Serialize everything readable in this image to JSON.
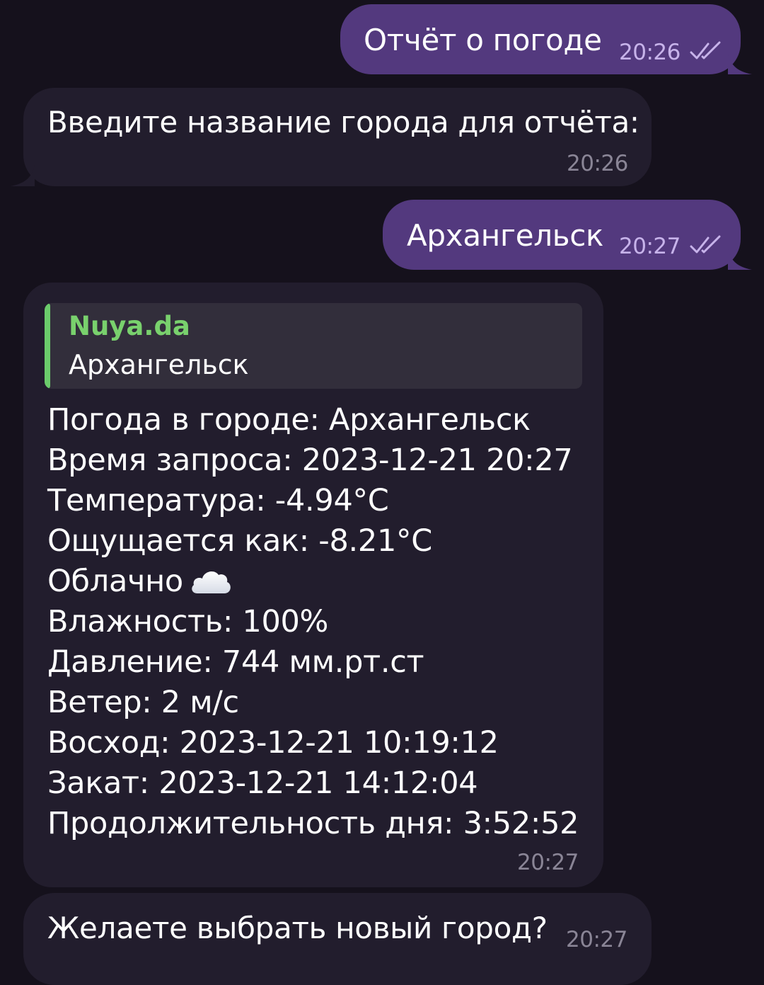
{
  "messages": {
    "m1": {
      "text": "Отчёт о погоде",
      "time": "20:26"
    },
    "m2": {
      "text": "Введите название города для отчёта:",
      "time": "20:26"
    },
    "m3": {
      "text": "Архангельск",
      "time": "20:27"
    },
    "m4": {
      "reply_name": "Nuya.da",
      "reply_text": "Архангельск",
      "lines": [
        "Погода в городе: Архангельск",
        "Время запроса: 2023-12-21 20:27",
        "Температура: -4.94°C",
        "Ощущается как: -8.21°C",
        "Облачно",
        "Влажность: 100%",
        "Давление: 744 мм.рт.ст",
        "Ветер: 2 м/с",
        "Восход: 2023-12-21 10:19:12",
        "Закат: 2023-12-21 14:12:04",
        "Продолжительность дня: 3:52:52"
      ],
      "time": "20:27"
    },
    "m5": {
      "text": "Желаете выбрать новый город?",
      "time": "20:27"
    }
  },
  "icons": {
    "cloud": "cloud-icon",
    "read_status": "double-check-icon"
  },
  "colors": {
    "background": "#15111c",
    "outgoing_bubble": "#53397e",
    "incoming_bubble": "#221d2d",
    "reply_accent": "#6bcb6b"
  }
}
